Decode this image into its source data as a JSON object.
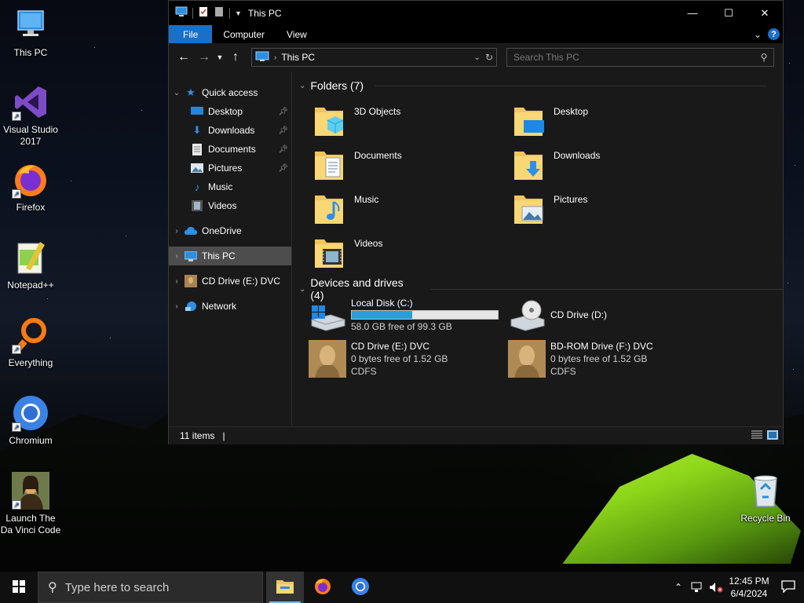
{
  "desktop": {
    "icons": [
      {
        "label": "This PC",
        "icon": "computer-icon"
      },
      {
        "label": "Visual Studio 2017",
        "icon": "visual-studio-icon"
      },
      {
        "label": "Firefox",
        "icon": "firefox-icon"
      },
      {
        "label": "Notepad++",
        "icon": "notepadpp-icon"
      },
      {
        "label": "Everything",
        "icon": "everything-search-icon"
      },
      {
        "label": "Chromium",
        "icon": "chromium-icon"
      },
      {
        "label": "Launch The Da Vinci Code",
        "icon": "mona-lisa-icon"
      }
    ],
    "recycle_bin": {
      "label": "Recycle Bin",
      "icon": "recycle-bin-icon"
    }
  },
  "explorer": {
    "title": "This PC",
    "ribbon_tabs": [
      "File",
      "Computer",
      "View"
    ],
    "help_label": "?",
    "address": {
      "crumb": "This PC"
    },
    "search": {
      "placeholder": "Search This PC"
    },
    "sidebar": {
      "quick_access": "Quick access",
      "quick_items": [
        {
          "label": "Desktop",
          "icon": "desktop-folder-icon",
          "pinned": true
        },
        {
          "label": "Downloads",
          "icon": "downloads-folder-icon",
          "pinned": true
        },
        {
          "label": "Documents",
          "icon": "documents-folder-icon",
          "pinned": true
        },
        {
          "label": "Pictures",
          "icon": "pictures-folder-icon",
          "pinned": true
        },
        {
          "label": "Music",
          "icon": "music-folder-icon",
          "pinned": false
        },
        {
          "label": "Videos",
          "icon": "videos-folder-icon",
          "pinned": false
        }
      ],
      "onedrive": "OneDrive",
      "this_pc": "This PC",
      "cd_drive": "CD Drive (E:) DVC",
      "network": "Network"
    },
    "groups": {
      "folders_header": "Folders (7)",
      "devices_header": "Devices and drives (4)"
    },
    "folders": [
      {
        "name": "3D Objects",
        "icon": "3d-objects-folder-icon"
      },
      {
        "name": "Desktop",
        "icon": "desktop-folder-icon"
      },
      {
        "name": "Documents",
        "icon": "documents-folder-icon"
      },
      {
        "name": "Downloads",
        "icon": "downloads-folder-icon"
      },
      {
        "name": "Music",
        "icon": "music-folder-icon"
      },
      {
        "name": "Pictures",
        "icon": "pictures-folder-icon"
      },
      {
        "name": "Videos",
        "icon": "videos-folder-icon"
      }
    ],
    "drives": [
      {
        "name": "Local Disk (C:)",
        "line2": "58.0 GB free of 99.3 GB",
        "line3": "",
        "used_fraction": 0.416,
        "icon": "windows-drive-icon"
      },
      {
        "name": "CD Drive (D:)",
        "line2": "",
        "line3": "",
        "icon": "cd-drive-icon"
      },
      {
        "name": "CD Drive (E:) DVC",
        "line2": "0 bytes free of 1.52 GB",
        "line3": "CDFS",
        "icon": "davinci-disc-icon"
      },
      {
        "name": "BD-ROM Drive (F:) DVC",
        "line2": "0 bytes free of 1.52 GB",
        "line3": "CDFS",
        "icon": "davinci-disc-icon"
      }
    ],
    "status": {
      "items": "11 items",
      "separator": "|"
    }
  },
  "taskbar": {
    "search_placeholder": "Type here to search",
    "apps": [
      "file-explorer-icon",
      "firefox-icon",
      "chromium-icon"
    ],
    "time": "12:45 PM",
    "date": "6/4/2024"
  },
  "colors": {
    "accent": "#1a6fc9",
    "capacity_fill": "#26a0da",
    "selected": "#4d4d4d"
  }
}
